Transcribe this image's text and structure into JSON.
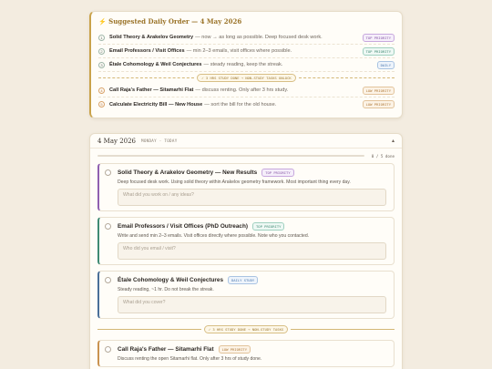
{
  "order": {
    "title": "⚡ Suggested Daily Order — 4 May 2026",
    "items": [
      {
        "num": "1",
        "name": "Solid Theory & Arakelov Geometry",
        "note": "— now → as long as possible. Deep focused desk work.",
        "tag": "TOP PRIORITY"
      },
      {
        "num": "2",
        "name": "Email Professors / Visit Offices",
        "note": "— min 2–3 emails, visit offices where possible.",
        "tag": "TOP PRIORITY"
      },
      {
        "num": "3",
        "name": "Étale Cohomology & Weil Conjectures",
        "note": "— steady reading, keep the streak.",
        "tag": "DAILY"
      }
    ],
    "divider": "✓ 3 HRS STUDY DONE → NON-STUDY TASKS UNLOCK",
    "later": [
      {
        "num": "4",
        "name": "Call Raja's Father — Sitamarhi Flat",
        "note": "— discuss renting. Only after 3 hrs study.",
        "tag": "LOW PRIORITY"
      },
      {
        "num": "5",
        "name": "Calculate Electricity Bill — New House",
        "note": "— sort the bill for the old house.",
        "tag": "LOW PRIORITY"
      }
    ]
  },
  "day": {
    "date": "4 May 2026",
    "meta": "MONDAY · TODAY",
    "collapse": "▴",
    "progress_text": "0 / 5 done",
    "progress_fraction": 0.0
  },
  "tasks": [
    {
      "title": "Solid Theory & Arakelov Geometry — New Results",
      "tag": "TOP PRIORITY",
      "desc": "Deep focused desk work. Using solid theory within Arakelov geometry framework. Most important thing every day.",
      "placeholder": "What did you work on / any ideas?"
    },
    {
      "title": "Email Professors / Visit Offices (PhD Outreach)",
      "tag": "TOP PRIORITY",
      "desc": "Write and send min 2–3 emails. Visit offices directly where possible. Note who you contacted.",
      "placeholder": "Who did you email / visit?"
    },
    {
      "title": "Étale Cohomology & Weil Conjectures",
      "tag": "DAILY STUDY",
      "desc": "Steady reading, ~1 hr. Do not break the streak.",
      "placeholder": "What did you cover?"
    }
  ],
  "split_label": "✓ 3 HRS STUDY DONE → NON-STUDY TASKS",
  "task4": {
    "title": "Call Raja's Father — Sitamarhi Flat",
    "tag": "LOW PRIORITY",
    "desc": "Discuss renting the open Sitamarhi flat. Only after 3 hrs of study done."
  },
  "colors": {
    "accent": "#c9a24a",
    "purple": "#8f5fb0",
    "green": "#3f8a73",
    "blue": "#4a6f98",
    "orange": "#c9924f"
  }
}
